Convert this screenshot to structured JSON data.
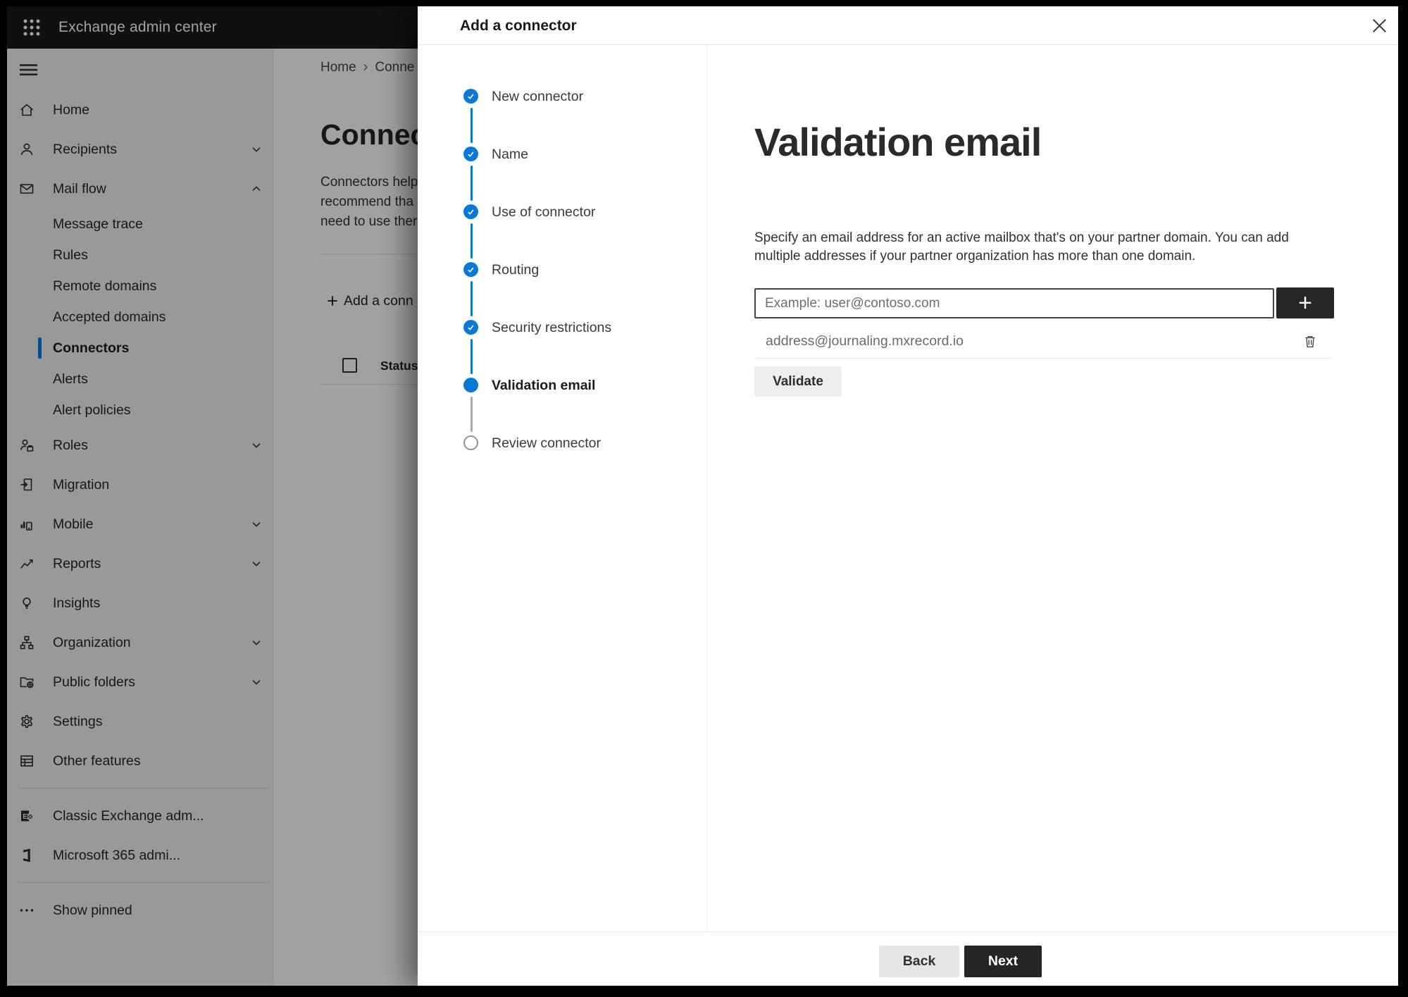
{
  "app": {
    "header_title": "Exchange admin center"
  },
  "sidebar": {
    "items": [
      {
        "type": "main",
        "icon": "home-icon",
        "label": "Home"
      },
      {
        "type": "main",
        "icon": "recipients-icon",
        "label": "Recipients",
        "chevron": "down"
      },
      {
        "type": "main",
        "icon": "mail-flow-icon",
        "label": "Mail flow",
        "chevron": "up"
      },
      {
        "type": "sub",
        "label": "Message trace"
      },
      {
        "type": "sub",
        "label": "Rules"
      },
      {
        "type": "sub",
        "label": "Remote domains"
      },
      {
        "type": "sub",
        "label": "Accepted domains"
      },
      {
        "type": "sub",
        "label": "Connectors",
        "selected": true
      },
      {
        "type": "sub",
        "label": "Alerts"
      },
      {
        "type": "sub",
        "label": "Alert policies"
      },
      {
        "type": "main",
        "icon": "roles-icon",
        "label": "Roles",
        "chevron": "down"
      },
      {
        "type": "main",
        "icon": "migration-icon",
        "label": "Migration"
      },
      {
        "type": "main",
        "icon": "mobile-icon",
        "label": "Mobile",
        "chevron": "down"
      },
      {
        "type": "main",
        "icon": "reports-icon",
        "label": "Reports",
        "chevron": "down"
      },
      {
        "type": "main",
        "icon": "insights-icon",
        "label": "Insights"
      },
      {
        "type": "main",
        "icon": "organization-icon",
        "label": "Organization",
        "chevron": "down"
      },
      {
        "type": "main",
        "icon": "public-folders-icon",
        "label": "Public folders",
        "chevron": "down"
      },
      {
        "type": "main",
        "icon": "settings-icon",
        "label": "Settings"
      },
      {
        "type": "main",
        "icon": "other-features-icon",
        "label": "Other features"
      },
      {
        "type": "divider"
      },
      {
        "type": "main",
        "icon": "classic-exchange-icon",
        "label": "Classic Exchange adm..."
      },
      {
        "type": "main",
        "icon": "microsoft-365-icon",
        "label": "Microsoft 365 admi..."
      },
      {
        "type": "divider"
      },
      {
        "type": "main",
        "icon": "show-pinned-icon",
        "label": "Show pinned"
      }
    ]
  },
  "page": {
    "breadcrumb": {
      "home": "Home",
      "separator": "›",
      "current": "Conne"
    },
    "title": "Connect",
    "intro_lines": [
      "Connectors help",
      "recommend tha",
      "need to use ther"
    ],
    "toolbar": {
      "plus_glyph": "+",
      "add_connector_label": "Add a conn"
    },
    "grid": {
      "status_header": "Status"
    }
  },
  "dialog": {
    "title": "Add a connector",
    "steps": [
      {
        "label": "New connector",
        "state": "done"
      },
      {
        "label": "Name",
        "state": "done"
      },
      {
        "label": "Use of connector",
        "state": "done"
      },
      {
        "label": "Routing",
        "state": "done"
      },
      {
        "label": "Security restrictions",
        "state": "done"
      },
      {
        "label": "Validation email",
        "state": "current"
      },
      {
        "label": "Review connector",
        "state": "todo"
      }
    ],
    "content": {
      "heading": "Validation email",
      "description_line1": "Specify an email address for an active mailbox that's on your partner domain. You can add",
      "description_line2": "multiple addresses if your partner organization has more than one domain.",
      "email_placeholder": "Example: user@contoso.com",
      "email_value": "",
      "add_email_glyph": "+",
      "emails": [
        "address@journaling.mxrecord.io"
      ],
      "validate_label": "Validate"
    },
    "footer": {
      "back_label": "Back",
      "next_label": "Next"
    }
  },
  "colors": {
    "accent_blue": "#0b79d4",
    "step_todo_border": "#949494",
    "topbar_bg": "#1b1a19",
    "sidebar_bg": "#f3f2f1"
  }
}
